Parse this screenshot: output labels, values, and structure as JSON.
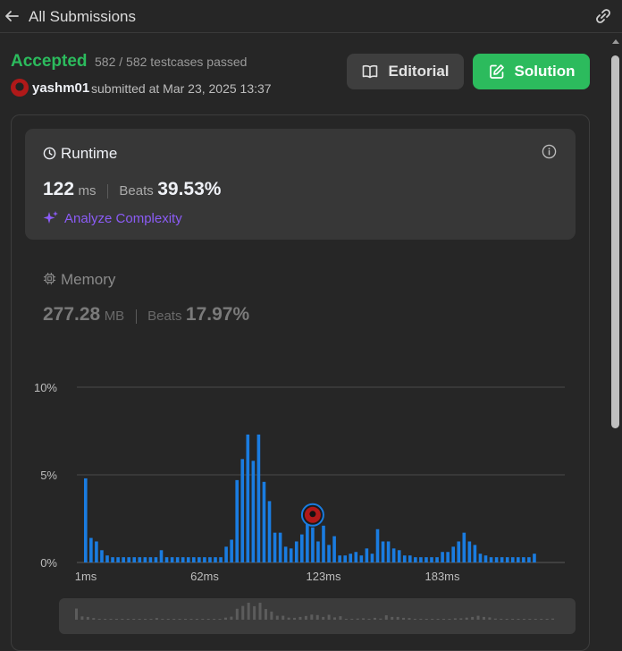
{
  "header": {
    "title": "All Submissions",
    "back_icon": "arrow-left-icon",
    "share_icon": "link-icon"
  },
  "result": {
    "status": "Accepted",
    "status_color": "#2cbb5d",
    "testcases": "582 / 582 testcases passed",
    "username": "yashm01",
    "submitted": "submitted at Mar 23, 2025 13:37"
  },
  "buttons": {
    "editorial": "Editorial",
    "solution": "Solution"
  },
  "runtime": {
    "label": "Runtime",
    "value": "122",
    "unit": "ms",
    "beats_label": "Beats",
    "beats": "39.53%",
    "analyze": "Analyze Complexity"
  },
  "memory": {
    "label": "Memory",
    "value": "277.28",
    "unit": "MB",
    "beats_label": "Beats",
    "beats": "17.97%"
  },
  "chart_data": {
    "type": "bar",
    "ylim": [
      0,
      10
    ],
    "y_ticks": [
      "10%",
      "5%",
      "0%"
    ],
    "x_ticks": [
      "1ms",
      "62ms",
      "123ms",
      "183ms"
    ],
    "bar_color": "#1a7ce0",
    "highlight_index": 42,
    "values": [
      4.8,
      1.4,
      1.2,
      0.7,
      0.4,
      0.3,
      0.3,
      0.3,
      0.3,
      0.3,
      0.3,
      0.3,
      0.3,
      0.3,
      0.7,
      0.3,
      0.3,
      0.3,
      0.3,
      0.3,
      0.3,
      0.3,
      0.3,
      0.3,
      0.3,
      0.3,
      0.9,
      1.3,
      4.7,
      5.9,
      7.3,
      5.8,
      7.3,
      4.6,
      3.5,
      1.7,
      1.7,
      0.9,
      0.8,
      1.2,
      1.6,
      2.2,
      2.0,
      1.2,
      2.1,
      1.0,
      1.5,
      0.4,
      0.4,
      0.5,
      0.6,
      0.4,
      0.8,
      0.5,
      1.9,
      1.2,
      1.2,
      0.8,
      0.7,
      0.4,
      0.4,
      0.3,
      0.3,
      0.3,
      0.3,
      0.3,
      0.6,
      0.6,
      0.9,
      1.2,
      1.7,
      1.2,
      1.0,
      0.5,
      0.4,
      0.3,
      0.3,
      0.3,
      0.3,
      0.3,
      0.3,
      0.3,
      0.3,
      0.5
    ]
  }
}
